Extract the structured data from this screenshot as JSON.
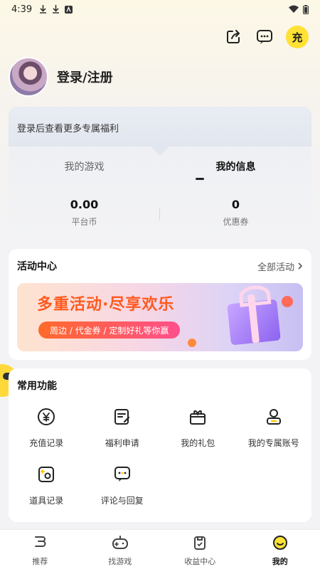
{
  "status_bar": {
    "time": "4:39"
  },
  "header": {
    "charge_label": "充"
  },
  "profile": {
    "login_label": "登录/注册"
  },
  "info_card": {
    "notice": "登录后查看更多专属福利",
    "tabs": [
      {
        "label": "我的游戏",
        "active": false
      },
      {
        "label": "我的信息",
        "active": true
      }
    ],
    "stats": [
      {
        "value": "0.00",
        "label": "平台币"
      },
      {
        "value": "0",
        "label": "优惠券"
      }
    ]
  },
  "activity": {
    "title": "活动中心",
    "more_label": "全部活动",
    "banner": {
      "title": "多重活动·尽享欢乐",
      "tags": "周边 / 代金券 / 定制好礼等你赢"
    }
  },
  "functions": {
    "title": "常用功能",
    "items": [
      {
        "label": "充值记录",
        "icon": "recharge-icon"
      },
      {
        "label": "福利申请",
        "icon": "apply-icon"
      },
      {
        "label": "我的礼包",
        "icon": "gift-icon"
      },
      {
        "label": "我的专属账号",
        "icon": "account-icon"
      },
      {
        "label": "道具记录",
        "icon": "item-icon"
      },
      {
        "label": "评论与回复",
        "icon": "comment-icon"
      }
    ]
  },
  "bottom_nav": {
    "items": [
      {
        "label": "推荐",
        "icon": "recommend-icon",
        "active": false
      },
      {
        "label": "找游戏",
        "icon": "gamepad-icon",
        "active": false
      },
      {
        "label": "收益中心",
        "icon": "earnings-icon",
        "active": false
      },
      {
        "label": "我的",
        "icon": "profile-icon",
        "active": true
      }
    ]
  },
  "colors": {
    "accent": "#ffe234",
    "banner_title": "#ff5a1f"
  }
}
